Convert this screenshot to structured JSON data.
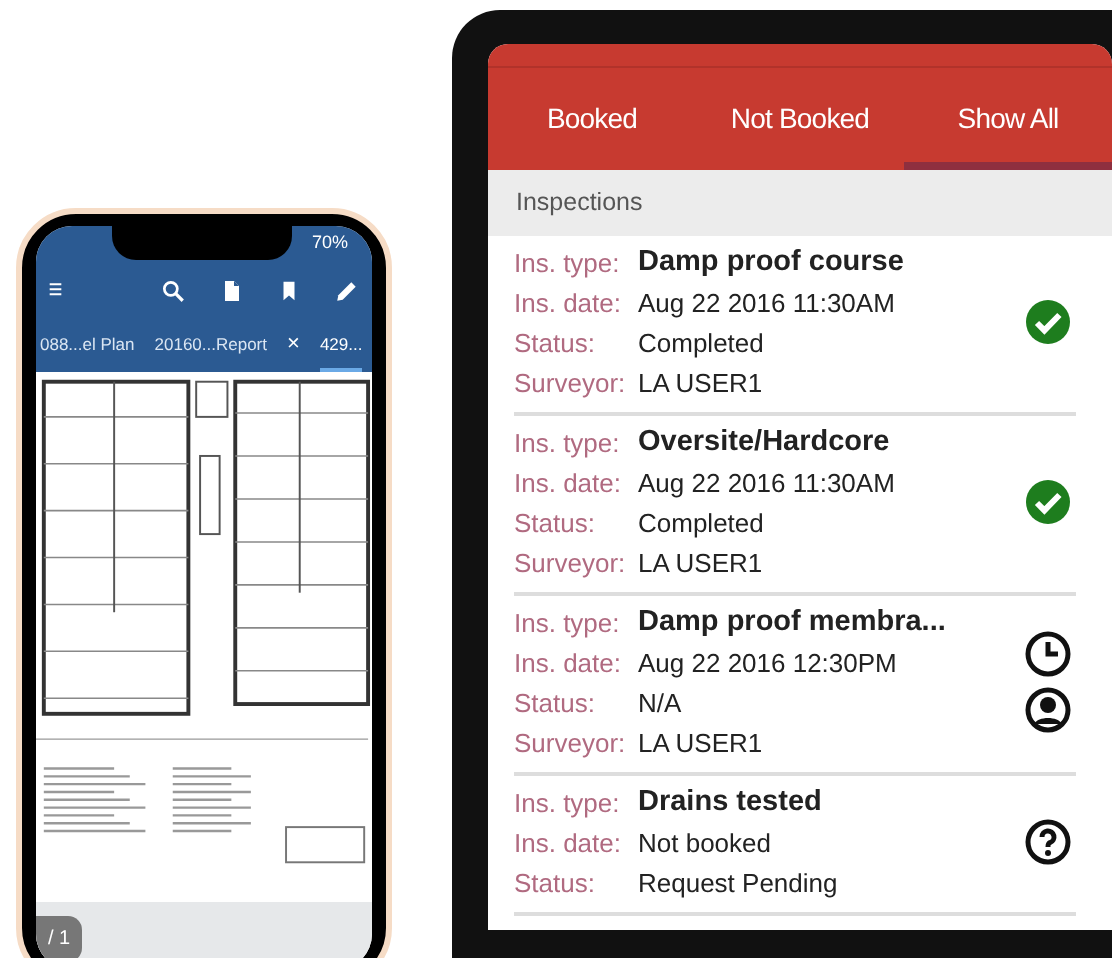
{
  "phone": {
    "status_bar": {
      "battery": "70%"
    },
    "doc_tabs": [
      {
        "label": "088...el Plan",
        "selected": false,
        "closable": false
      },
      {
        "label": "20160...Report",
        "selected": false,
        "closable": false
      },
      {
        "label": "429...",
        "selected": true,
        "closable": true
      }
    ],
    "close_glyph": "×",
    "page_indicator": "/ 1"
  },
  "tablet": {
    "tabs": [
      {
        "label": "Booked",
        "selected": false
      },
      {
        "label": "Not Booked",
        "selected": false
      },
      {
        "label": "Show All",
        "selected": true
      }
    ],
    "section_title": "Inspections",
    "inspections": [
      {
        "fields": [
          {
            "label": "Ins. type:",
            "value": "Damp proof course"
          },
          {
            "label": "Ins. date:",
            "value": "Aug 22 2016 11:30AM"
          },
          {
            "label": "Status:",
            "value": "Completed"
          },
          {
            "label": "Surveyor:",
            "value": "LA USER1"
          }
        ],
        "icons": [
          {
            "kind": "check"
          }
        ]
      },
      {
        "fields": [
          {
            "label": "Ins. type:",
            "value": "Oversite/Hardcore"
          },
          {
            "label": "Ins. date:",
            "value": "Aug 22 2016 11:30AM"
          },
          {
            "label": "Status:",
            "value": "Completed"
          },
          {
            "label": "Surveyor:",
            "value": "LA USER1"
          }
        ],
        "icons": [
          {
            "kind": "check"
          }
        ]
      },
      {
        "fields": [
          {
            "label": "Ins. type:",
            "value": "Damp proof membra..."
          },
          {
            "label": "Ins. date:",
            "value": "Aug 22 2016 12:30PM"
          },
          {
            "label": "Status:",
            "value": "N/A"
          },
          {
            "label": "Surveyor:",
            "value": "LA USER1"
          }
        ],
        "icons": [
          {
            "kind": "clock"
          },
          {
            "kind": "person"
          }
        ]
      },
      {
        "fields": [
          {
            "label": "Ins. type:",
            "value": "Drains tested"
          },
          {
            "label": "Ins. date:",
            "value": "Not booked"
          },
          {
            "label": "Status:",
            "value": "Request Pending"
          }
        ],
        "icons": [
          {
            "kind": "question"
          }
        ]
      }
    ]
  }
}
